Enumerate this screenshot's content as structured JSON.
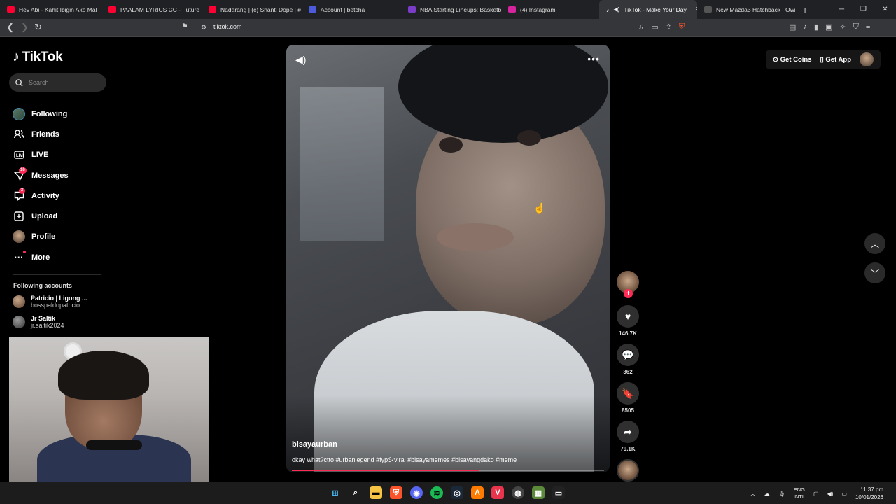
{
  "browser": {
    "tabs": [
      {
        "label": "Hev Abi - Kahit Ibigin Ako Mal",
        "color": "#ff0033"
      },
      {
        "label": "PAALAM LYRICS CC - Future Th",
        "color": "#ff0033"
      },
      {
        "label": "Nadarang | (c) Shanti Dope | #",
        "color": "#ff0033"
      },
      {
        "label": "Account | betcha",
        "color": "#4b5bdc"
      },
      {
        "label": "NBA Starting Lineups: Basketb",
        "color": "#7a3cc9"
      },
      {
        "label": "(4) Instagram",
        "color": "#d6249f"
      },
      {
        "label": "TikTok - Make Your Day",
        "color": "#000000"
      },
      {
        "label": "New Mazda3 Hatchback | Own",
        "color": "#555555"
      }
    ],
    "url": "tiktok.com"
  },
  "sidebar": {
    "logo": "TikTok",
    "search_placeholder": "Search",
    "items": [
      {
        "label": "Following",
        "icon": "following-avatar-icon"
      },
      {
        "label": "Friends",
        "icon": "friends-icon"
      },
      {
        "label": "LIVE",
        "icon": "live-icon"
      },
      {
        "label": "Messages",
        "icon": "messages-icon",
        "badge": "16"
      },
      {
        "label": "Activity",
        "icon": "activity-icon",
        "badge": "3"
      },
      {
        "label": "Upload",
        "icon": "upload-icon"
      },
      {
        "label": "Profile",
        "icon": "profile-avatar-icon"
      },
      {
        "label": "More",
        "icon": "more-icon"
      }
    ],
    "following_title": "Following accounts",
    "accounts": [
      {
        "name": "Patricio | Ligong ...",
        "handle": "bosspaldopatricio"
      },
      {
        "name": "Jr Saltik",
        "handle": "jr.saltik2024"
      }
    ]
  },
  "header": {
    "get_coins": "Get Coins",
    "get_app": "Get App"
  },
  "video": {
    "author": "bisayaurban",
    "caption": "okay what?ctto #urbanlegend #fypシviral #bisayamemes #bisayangdako #meme",
    "progress": 0.6
  },
  "actions": {
    "likes": "146.7K",
    "comments": "362",
    "saves": "8505",
    "shares": "79.1K"
  },
  "taskbar": {
    "lang_top": "ENG",
    "lang_bottom": "INTL",
    "time": "11:37 pm",
    "date": "10/01/2026"
  }
}
